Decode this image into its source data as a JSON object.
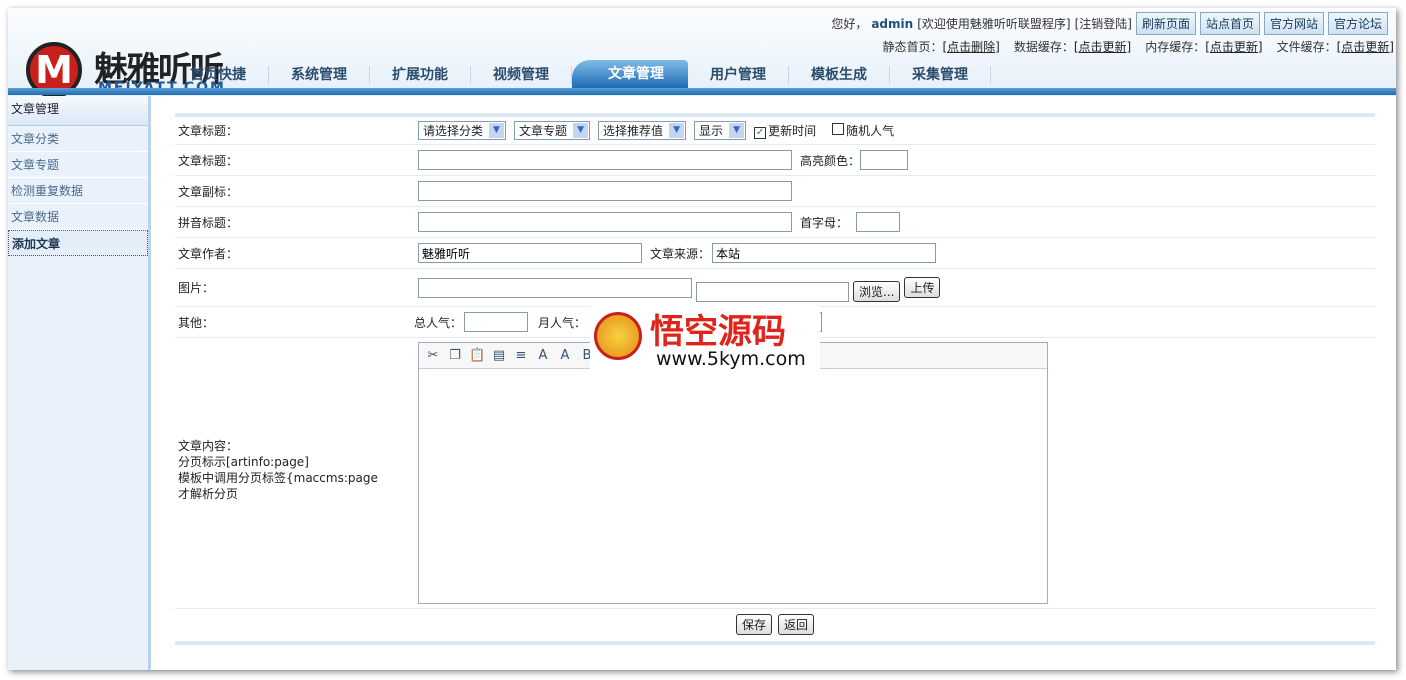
{
  "header": {
    "logo_cn": "魅雅听听",
    "logo_en": "MEIYATT.COM",
    "logo_letter": "M",
    "greeting": "您好，",
    "user": "admin",
    "welcome": "[欢迎使用魅雅听听联盟程序]",
    "logout": "[注销登陆]",
    "buttons": [
      "刷新页面",
      "站点首页",
      "官方网站",
      "官方论坛"
    ],
    "cache": [
      {
        "label": "静态首页：",
        "action": "[点击删除]"
      },
      {
        "label": "数据缓存：",
        "action": "[点击更新]"
      },
      {
        "label": "内存缓存：",
        "action": "[点击更新]"
      },
      {
        "label": "文件缓存：",
        "action": "[点击更新]"
      }
    ],
    "nav": [
      "首页快捷",
      "系统管理",
      "扩展功能",
      "视频管理",
      "文章管理",
      "用户管理",
      "模板生成",
      "采集管理"
    ],
    "active_nav": "文章管理"
  },
  "sidebar": {
    "title": "文章管理",
    "items": [
      "文章分类",
      "文章专题",
      "检测重复数据",
      "文章数据",
      "添加文章"
    ],
    "active": "添加文章"
  },
  "form": {
    "row1": {
      "label": "文章标题：",
      "category": "请选择分类",
      "topic": "文章专题",
      "recommend": "选择推荐值",
      "display": "显示",
      "update_time": "更新时间",
      "update_time_checked": true,
      "random_pop": "随机人气",
      "random_pop_checked": false
    },
    "row2": {
      "label": "文章标题：",
      "value": "",
      "color_label": "高亮颜色："
    },
    "row3": {
      "label": "文章副标：",
      "value": ""
    },
    "row4": {
      "label": "拼音标题：",
      "value": "",
      "initial_label": "首字母："
    },
    "row5": {
      "label": "文章作者：",
      "author": "魅雅听听",
      "source_label": "文章来源：",
      "source": "本站"
    },
    "row6": {
      "label": "图片：",
      "browse": "浏览...",
      "upload": "上传"
    },
    "row7": {
      "label": "其他：",
      "total_label": "总人气：",
      "month_label": "月人气：",
      "tail_label": "："
    },
    "row8": {
      "label": "文章内容：",
      "hint1": "分页标示[artinfo:page]",
      "hint2": "模板中调用分页标签{maccms:page",
      "hint3": "才解析分页"
    },
    "save": "保存",
    "back": "返回"
  },
  "editor_icons": [
    "cut-icon",
    "copy-icon",
    "paste-icon",
    "paste-text-icon",
    "paragraph-icon",
    "font-color-icon",
    "font-size-icon",
    "bold-icon",
    "indent-icon",
    "link-icon",
    "unlink-icon",
    "image-icon",
    "flash-icon",
    "media-icon",
    "table-icon",
    "source-icon",
    "preview-icon",
    "about-icon"
  ],
  "watermark": {
    "title": "悟空源码",
    "url": "www.5kym.com"
  }
}
